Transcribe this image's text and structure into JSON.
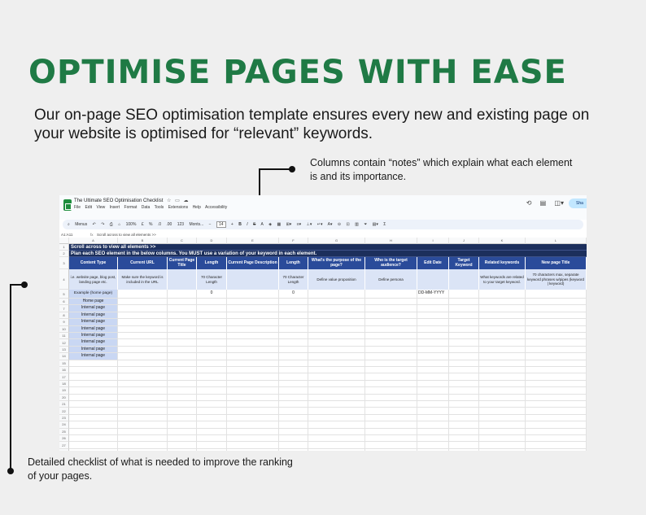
{
  "headline": "OPTIMISE PAGES WITH EASE",
  "intro": "Our on-page SEO optimisation template ensures every new and existing page on your website is optimised for “relevant” keywords.",
  "note_top": "Columns contain “notes” which explain what each element is and its importance.",
  "note_bottom": "Detailed checklist of what is needed to improve the ranking of your pages.",
  "sheets": {
    "doc_title": "The Ultimate SEO Optimisation Checklist",
    "menu": [
      "File",
      "Edit",
      "View",
      "Insert",
      "Format",
      "Data",
      "Tools",
      "Extensions",
      "Help",
      "Accessibility"
    ],
    "share_label": "Sha",
    "toolbar": {
      "menus": "Menus",
      "zoom": "100%",
      "currency": "£",
      "percent": "%",
      "dec_less": ".0",
      "dec_more": ".00",
      "number_format": "123",
      "font": "Monts...",
      "font_size": "14"
    },
    "cell_ref": "A1:A11",
    "formula_value": "Scroll across to view all elements >>",
    "col_letters": [
      "A",
      "B",
      "C",
      "D",
      "E",
      "F",
      "G",
      "H",
      "I",
      "J",
      "K",
      "L"
    ],
    "row_numbers": [
      "1",
      "2",
      "3",
      "4",
      "5",
      "6",
      "7",
      "8",
      "9",
      "10",
      "11",
      "12",
      "13",
      "14",
      "15",
      "16",
      "17",
      "18",
      "19",
      "20",
      "21",
      "22",
      "23",
      "24",
      "25",
      "26",
      "27",
      "28"
    ],
    "band1": "Scroll across to view all elements >>",
    "band2": "Plan each SEO element in the below columns. You MUST use a variation of your keyword in each element.",
    "headers": [
      "Content Type",
      "Current URL",
      "Current Page Title",
      "Length",
      "Current Page Description",
      "Length",
      "What's the purpose of the page?",
      "Who is the target audience?",
      "Edit Date",
      "Target Keyword",
      "Related keywords",
      "New page Title"
    ],
    "notes": [
      "i.e. website page, blog post, landing page etc.",
      "Make sure the keyword is included in the URL",
      "",
      "70 Character Length",
      "",
      "70 Character Length",
      "Define value proposition",
      "Define persona",
      "",
      "",
      "What keywords are related to your target keyword.",
      "70 characters max, separate keyword phrases w/pipes (keyword | keyword)"
    ],
    "example_label": "Example (home page)",
    "example_len1": "0",
    "example_len2": "0",
    "example_date": "DD-MM-YYYY",
    "internal_rows": [
      "Home page",
      "Internal page",
      "Internal page",
      "Internal page",
      "Internal page",
      "Internal page",
      "Internal page",
      "Internal page",
      "Internal page"
    ]
  },
  "colors": {
    "headline": "#1f7a45",
    "header_band": "#1c2f5c",
    "header_cell": "#2a4b9a",
    "note_cell": "#dbe4f6",
    "content_cell": "#c9d7f3"
  }
}
